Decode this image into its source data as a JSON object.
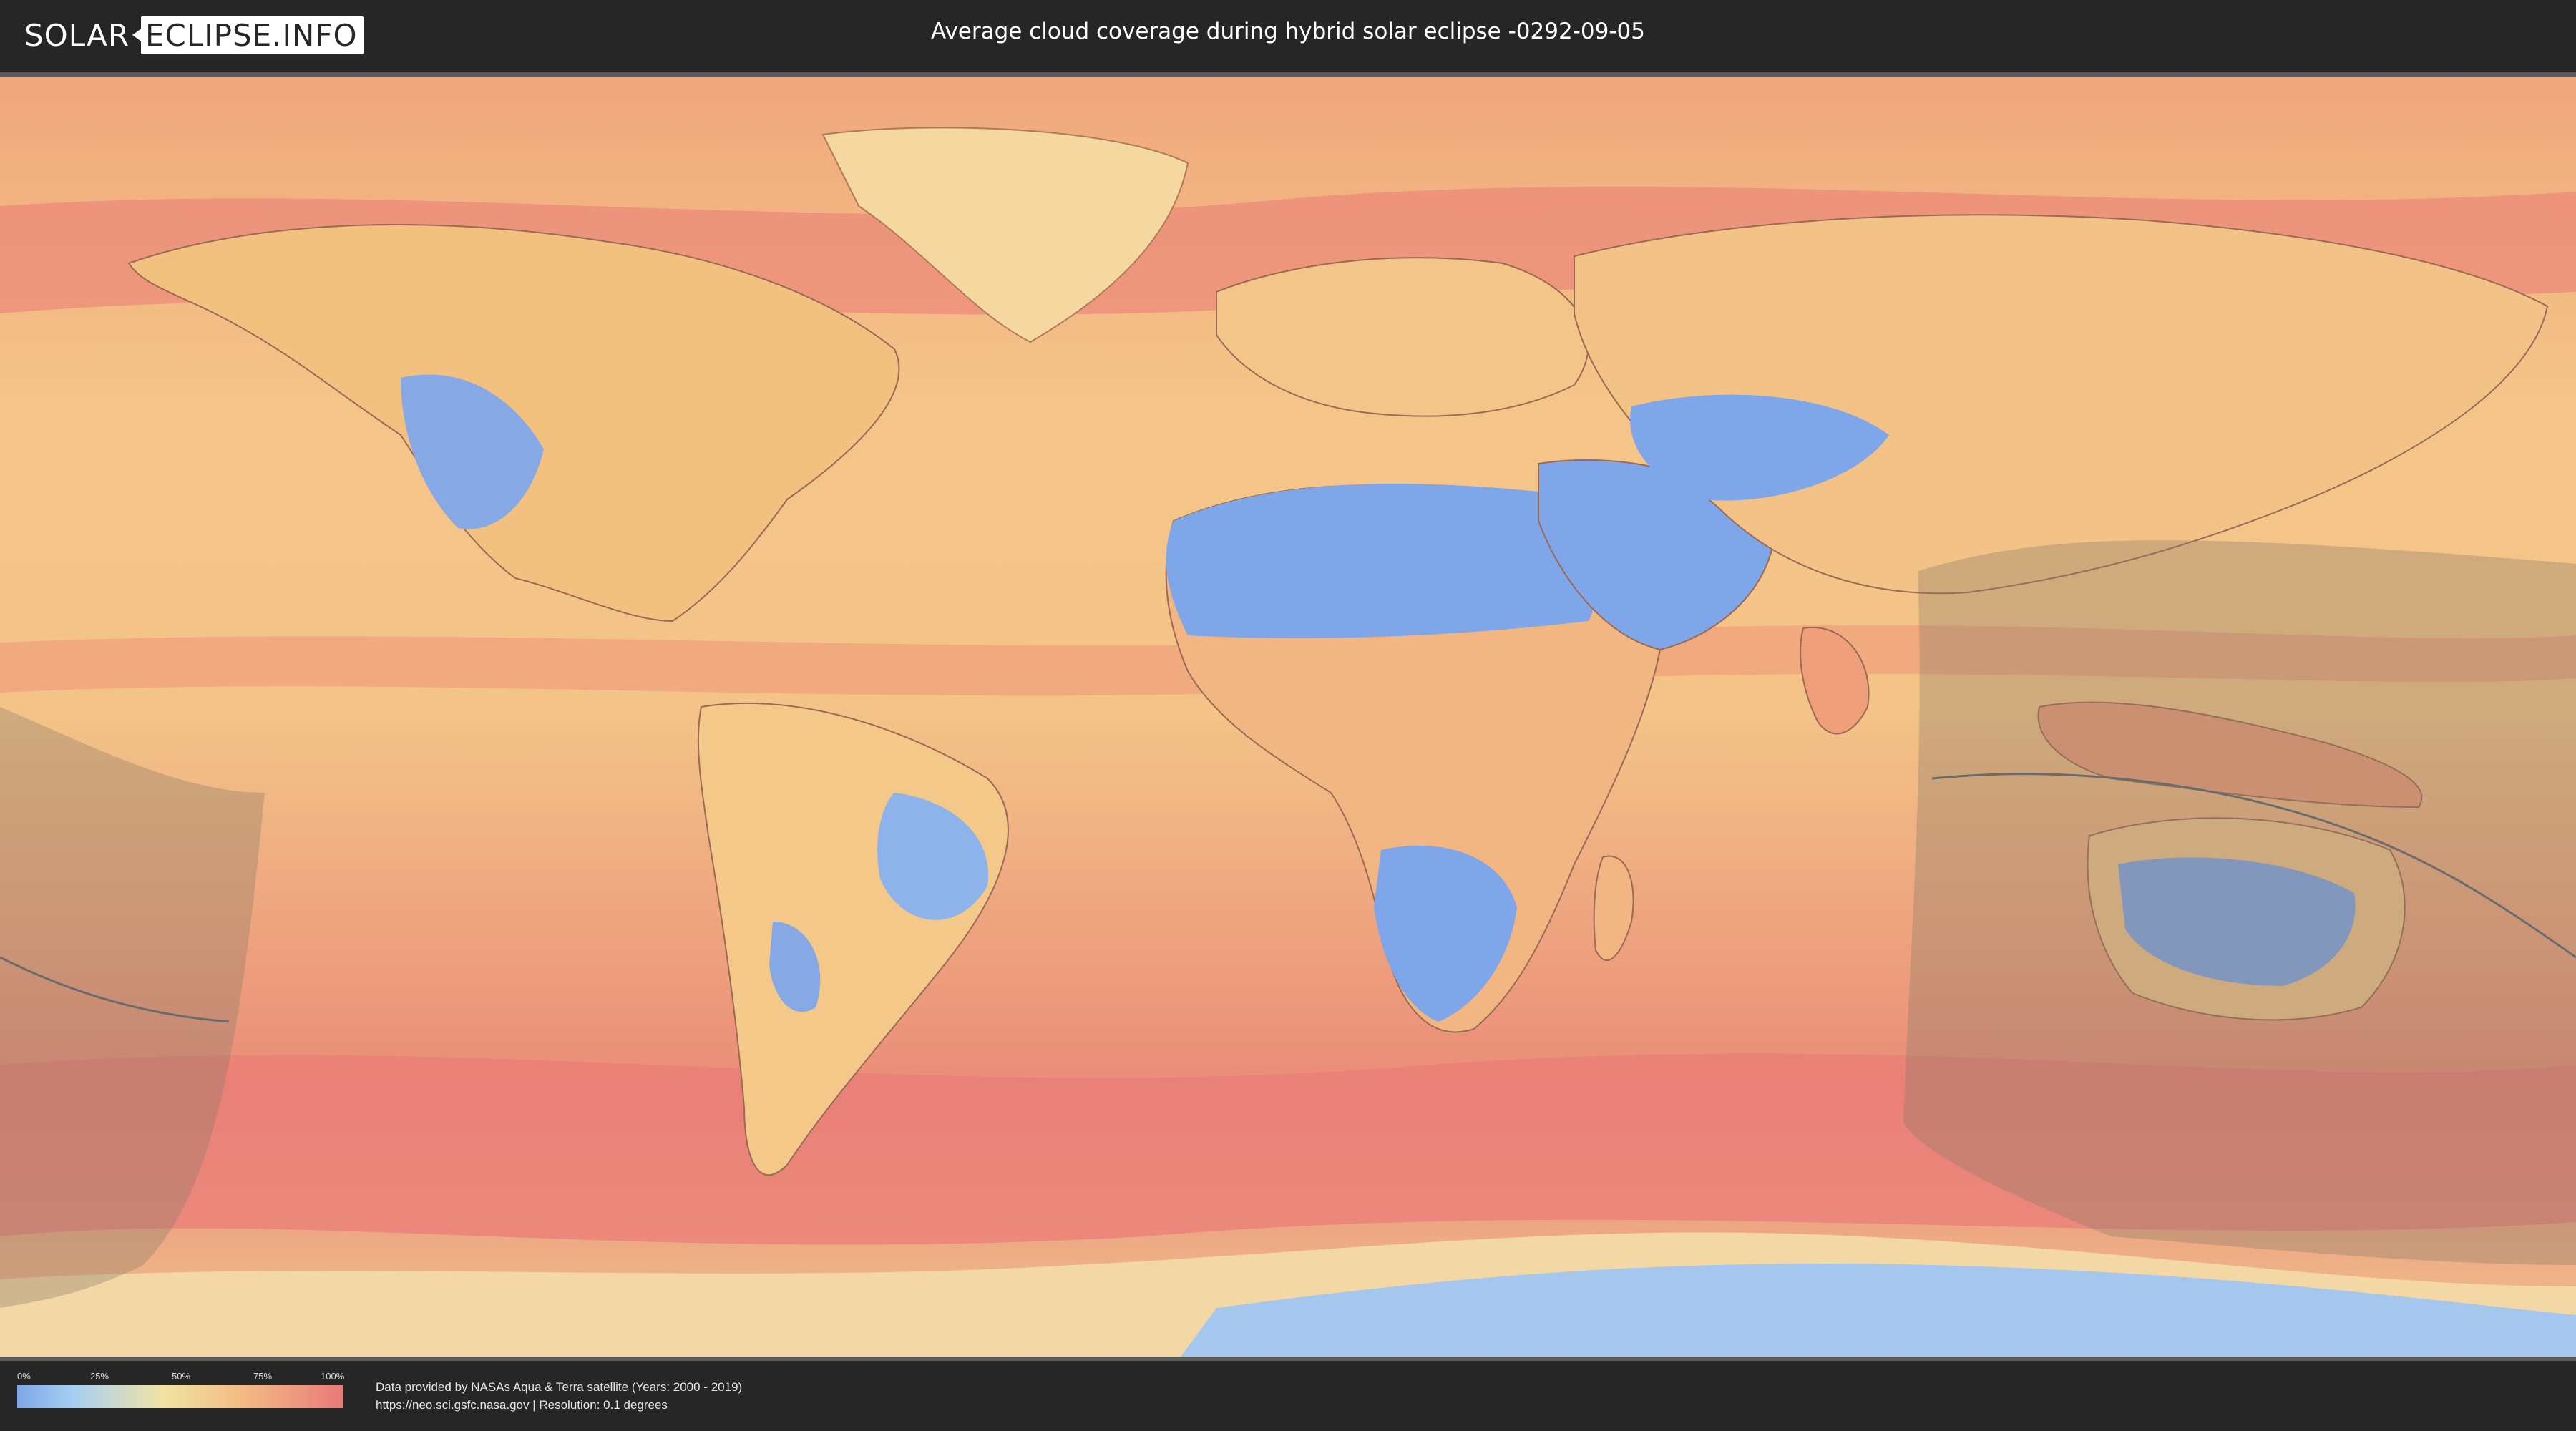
{
  "header": {
    "logo_solar": "SOLAR",
    "logo_eclipse": "ECLIPSE.INFO",
    "title": "Average cloud coverage during hybrid solar eclipse -0292-09-05"
  },
  "legend": {
    "ticks": [
      "0%",
      "25%",
      "50%",
      "75%",
      "100%"
    ],
    "colors": {
      "low": "#7ea6e8",
      "mid": "#f2e3a3",
      "high": "#e9797b"
    }
  },
  "credits": {
    "line1": "Data provided by NASAs Aqua & Terra satellite (Years: 2000 - 2019)",
    "line2": "https://neo.sci.gsfc.nasa.gov | Resolution: 0.1 degrees"
  },
  "map": {
    "ocean_color": "#ee9a73",
    "clear_color": "#7ea6e8",
    "cloudy_color": "#e9797b",
    "eclipse_zone_color": "#8a7a66"
  }
}
